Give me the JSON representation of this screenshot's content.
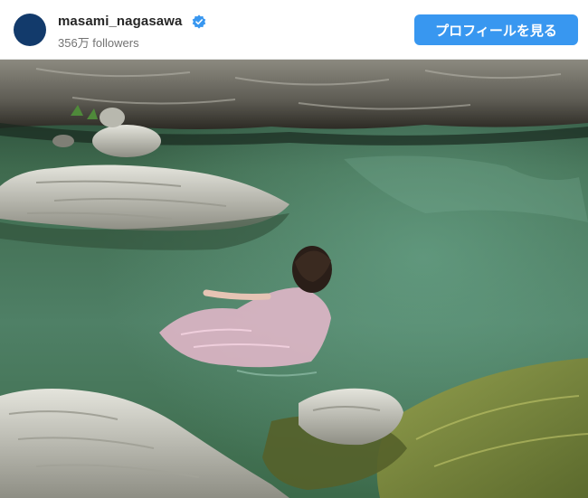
{
  "profile": {
    "username": "masami_nagasawa",
    "followers": "356万 followers",
    "button_label": "プロフィールを見る",
    "verified": true
  },
  "post": {
    "photo_icon": "swimming-photo"
  },
  "colors": {
    "button": "#3897f0",
    "verified": "#3897f0",
    "avatar": "#123a6b"
  }
}
